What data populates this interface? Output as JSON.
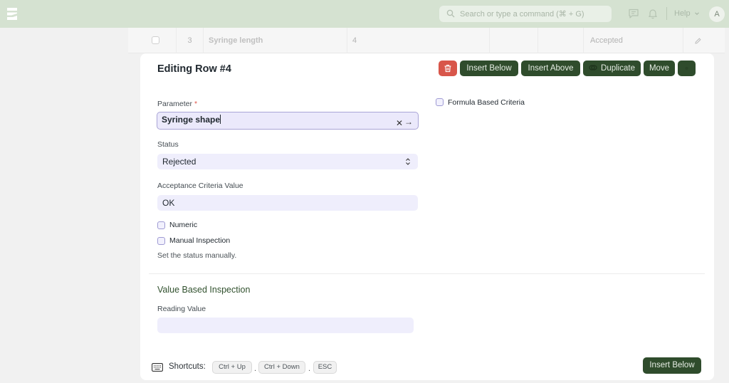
{
  "navbar": {
    "search_placeholder": "Search or type a command (⌘ + G)",
    "help_label": "Help",
    "avatar_initial": "A"
  },
  "grid_row": {
    "index": "3",
    "parameter": "Syringe length",
    "value": "4",
    "status": "Accepted"
  },
  "editor": {
    "title": "Editing Row #4",
    "buttons": {
      "insert_below": "Insert Below",
      "insert_above": "Insert Above",
      "duplicate": "Duplicate",
      "move": "Move"
    },
    "parameter": {
      "label": "Parameter",
      "required_mark": "*",
      "value": "Syringe shape"
    },
    "status": {
      "label": "Status",
      "value": "Rejected"
    },
    "acceptance": {
      "label": "Acceptance Criteria Value",
      "value": "OK"
    },
    "formula_based_label": "Formula Based Criteria",
    "numeric_label": "Numeric",
    "manual_label": "Manual Inspection",
    "manual_desc": "Set the status manually.",
    "value_section_title": "Value Based Inspection",
    "reading_value_label": "Reading Value",
    "reading_value": ""
  },
  "shortcuts": {
    "label": "Shortcuts:",
    "keys": [
      "Ctrl + Up",
      "Ctrl + Down",
      "ESC"
    ],
    "sep": "."
  },
  "footer_insert_below": "Insert Below",
  "colors": {
    "navbar_bg": "#d5e2d1",
    "primary_button": "#2f4c2c",
    "danger_button": "#d8564a",
    "input_bg": "#efeefc"
  }
}
